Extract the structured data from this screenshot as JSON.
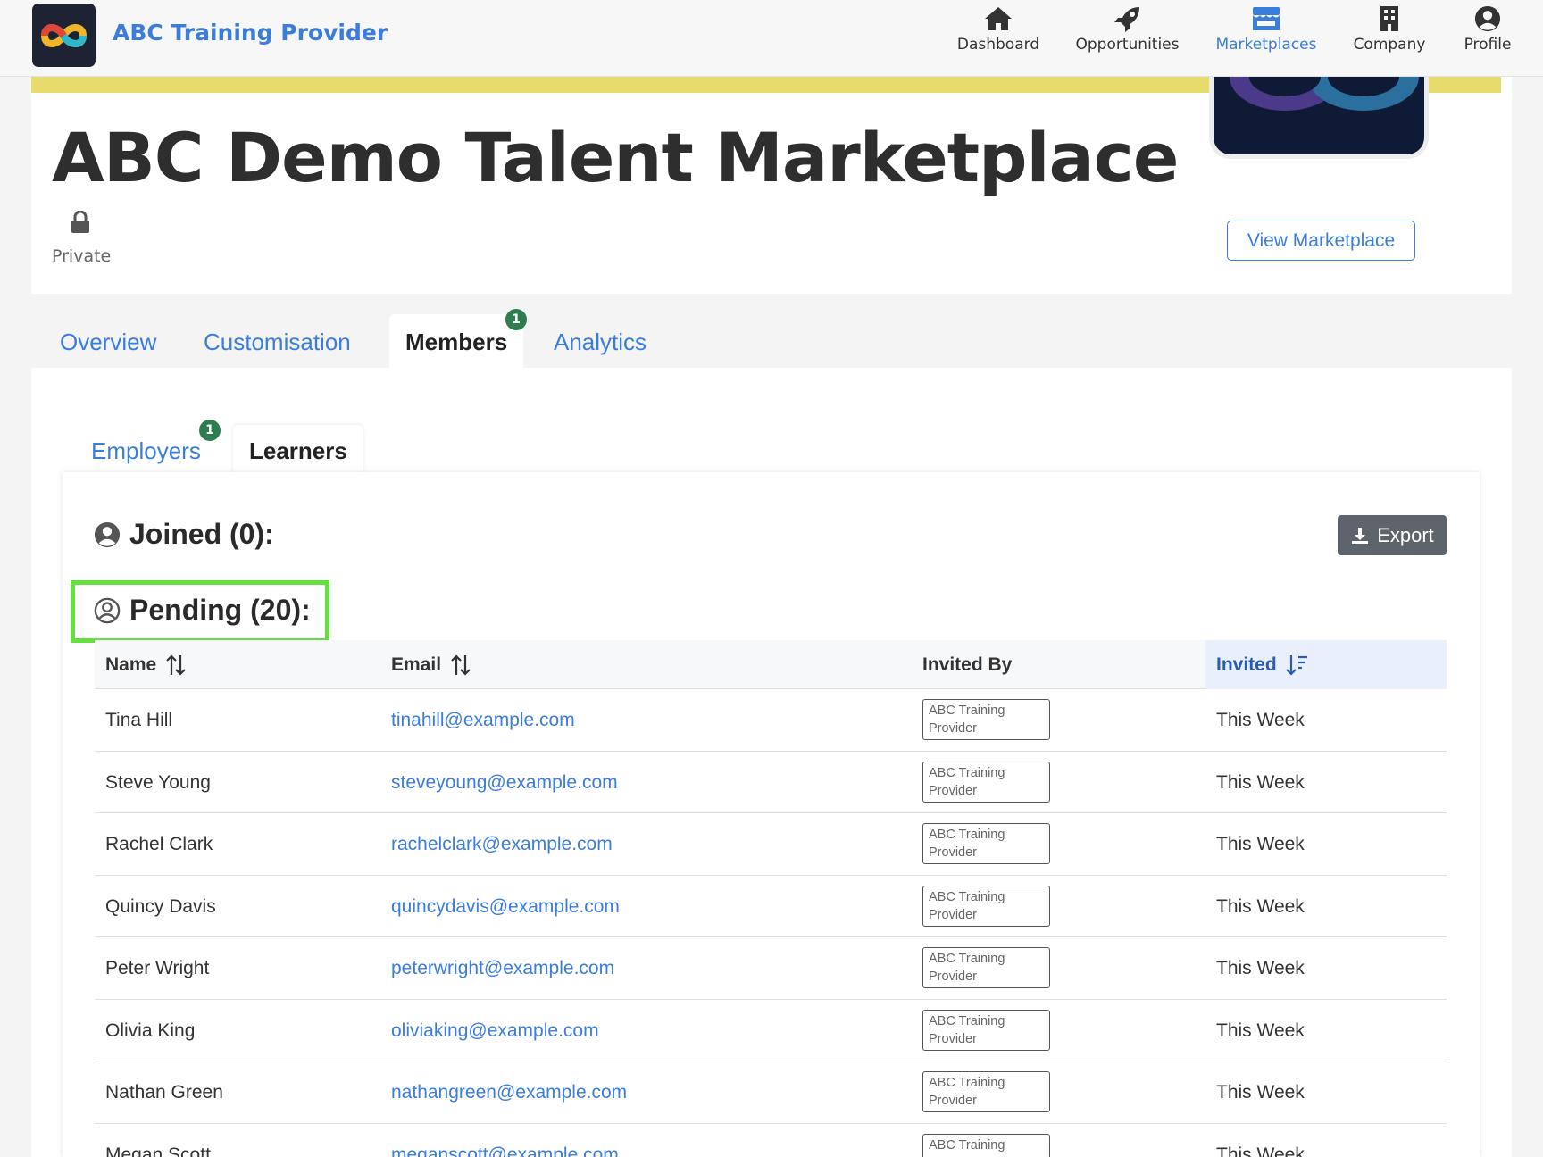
{
  "brand": {
    "name": "ABC Training Provider"
  },
  "nav": [
    {
      "label": "Dashboard",
      "icon": "home-icon",
      "active": false
    },
    {
      "label": "Opportunities",
      "icon": "rocket-icon",
      "active": false
    },
    {
      "label": "Marketplaces",
      "icon": "store-icon",
      "active": true
    },
    {
      "label": "Company",
      "icon": "building-icon",
      "active": false
    },
    {
      "label": "Profile",
      "icon": "user-circle-icon",
      "active": false
    }
  ],
  "marketplace": {
    "title": "ABC Demo Talent Marketplace",
    "visibility": "Private",
    "view_button": "View Marketplace"
  },
  "tabs": [
    {
      "label": "Overview"
    },
    {
      "label": "Customisation"
    },
    {
      "label": "Members",
      "active": true,
      "badge": "1"
    },
    {
      "label": "Analytics"
    }
  ],
  "subtabs": [
    {
      "label": "Employers",
      "badge": "1"
    },
    {
      "label": "Learners",
      "active": true
    }
  ],
  "joined": {
    "label": "Joined (0):"
  },
  "pending": {
    "label": "Pending (20):"
  },
  "export_label": "Export",
  "table": {
    "columns": [
      "Name",
      "Email",
      "Invited By",
      "Invited"
    ],
    "rows": [
      {
        "name": "Tina Hill",
        "email": "tinahill@example.com",
        "invited_by": "ABC Training Provider",
        "invited": "This Week"
      },
      {
        "name": "Steve Young",
        "email": "steveyoung@example.com",
        "invited_by": "ABC Training Provider",
        "invited": "This Week"
      },
      {
        "name": "Rachel Clark",
        "email": "rachelclark@example.com",
        "invited_by": "ABC Training Provider",
        "invited": "This Week"
      },
      {
        "name": "Quincy Davis",
        "email": "quincydavis@example.com",
        "invited_by": "ABC Training Provider",
        "invited": "This Week"
      },
      {
        "name": "Peter Wright",
        "email": "peterwright@example.com",
        "invited_by": "ABC Training Provider",
        "invited": "This Week"
      },
      {
        "name": "Olivia King",
        "email": "oliviaking@example.com",
        "invited_by": "ABC Training Provider",
        "invited": "This Week"
      },
      {
        "name": "Nathan Green",
        "email": "nathangreen@example.com",
        "invited_by": "ABC Training Provider",
        "invited": "This Week"
      },
      {
        "name": "Megan Scott",
        "email": "meganscott@example.com",
        "invited_by": "ABC Training Provider",
        "invited": "This Week"
      }
    ]
  },
  "colors": {
    "accent": "#3b7ddd",
    "badge": "#2e7d4f",
    "highlight": "#66e040",
    "banner": "#e7db6b"
  }
}
